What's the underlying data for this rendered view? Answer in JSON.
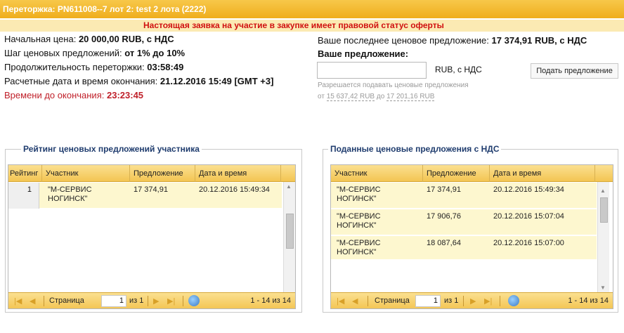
{
  "title": "Переторжка: PN611008--7 лот 2: test 2 лота (2222)",
  "notice": "Настоящая заявка на участие в закупке имеет правовой статус оферты",
  "info": {
    "start_price_label": "Начальная цена:",
    "start_price_value": "20 000,00 RUB, с НДС",
    "step_label": "Шаг ценовых предложений:",
    "step_value": "от 1% до 10%",
    "duration_label": "Продолжительность переторжки:",
    "duration_value": "03:58:49",
    "end_label": "Расчетные дата и время окончания:",
    "end_value": "21.12.2016 15:49 [GMT +3]",
    "remaining_label": "Времени до окончания:",
    "remaining_value": "23:23:45"
  },
  "offer": {
    "last_label": "Ваше последнее ценовое предложение:",
    "last_value": "17 374,91 RUB, с НДС",
    "your_offer_label": "Ваше предложение:",
    "input_value": "",
    "currency": "RUB, с НДС",
    "submit_label": "Подать предложение",
    "hint_line1": "Разрешается подавать ценовые предложения",
    "hint_from": "от",
    "hint_min": "15 637,42 RUB",
    "hint_to": "до",
    "hint_max": "17 201,16 RUB"
  },
  "left_panel": {
    "title": "Рейтинг ценовых предложений участника",
    "columns": [
      "Рейтинг",
      "Участник",
      "Предложение",
      "Дата и время"
    ],
    "rows": [
      {
        "rank": "1",
        "participant_line1": "\"М-СЕРВИС",
        "participant_line2": "НОГИНСК\"",
        "offer": "17 374,91",
        "datetime": "20.12.2016 15:49:34"
      }
    ],
    "pager": {
      "page_label": "Страница",
      "page_value": "1",
      "of_label": "из 1",
      "count": "1 - 14 из 14"
    }
  },
  "right_panel": {
    "title": "Поданные ценовые предложения с НДС",
    "columns": [
      "Участник",
      "Предложение",
      "Дата и время"
    ],
    "rows": [
      {
        "participant_line1": "\"М-СЕРВИС",
        "participant_line2": "НОГИНСК\"",
        "offer": "17 374,91",
        "datetime": "20.12.2016 15:49:34"
      },
      {
        "participant_line1": "\"М-СЕРВИС",
        "participant_line2": "НОГИНСК\"",
        "offer": "17 906,76",
        "datetime": "20.12.2016 15:07:04"
      },
      {
        "participant_line1": "\"М-СЕРВИС",
        "participant_line2": "НОГИНСК\"",
        "offer": "18 087,64",
        "datetime": "20.12.2016 15:07:00"
      }
    ],
    "pager": {
      "page_label": "Страница",
      "page_value": "1",
      "of_label": "из 1",
      "count": "1 - 14 из 14"
    }
  },
  "colors": {
    "accent": "#f3c553",
    "title_blue": "#1f3c6e",
    "alert_red": "#d01010",
    "row_highlight": "#fdf7cf"
  }
}
